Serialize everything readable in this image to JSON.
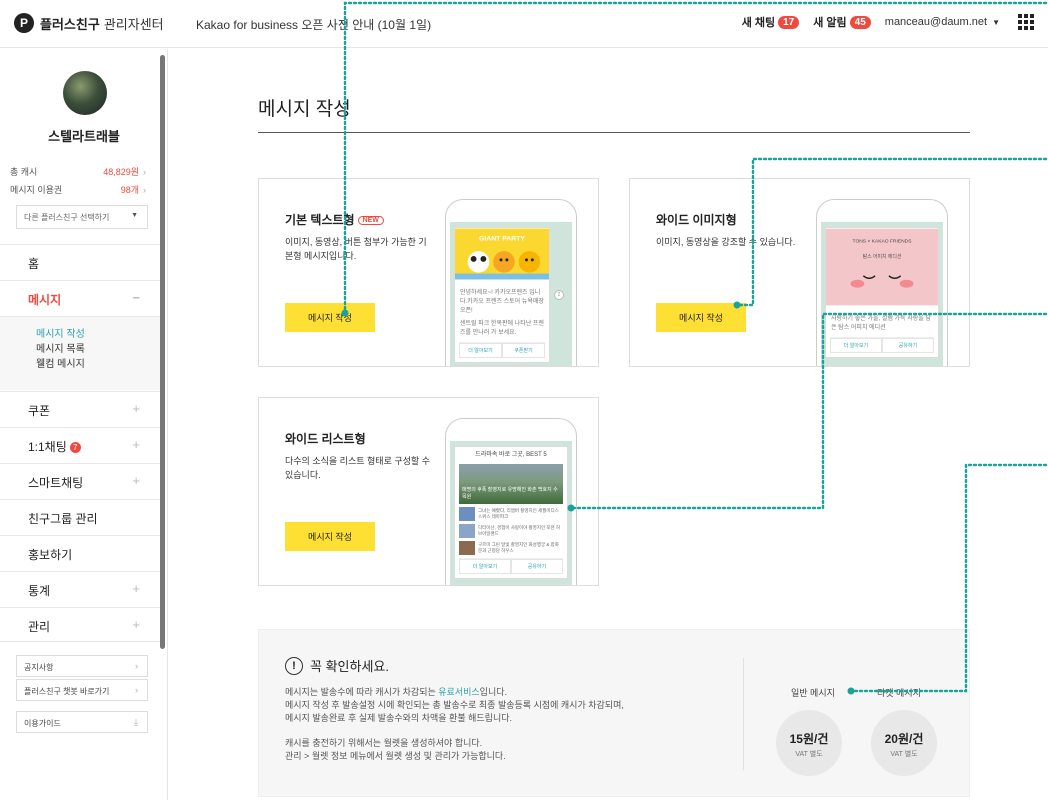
{
  "header": {
    "logo_mark": "P",
    "brand": "플러스친구",
    "brand_sub": "관리자센터",
    "notice": "Kakao for business 오픈 사전 안내 (10월 1일)",
    "new_chat_label": "새 채팅",
    "new_chat_count": "17",
    "new_alert_label": "새 알림",
    "new_alert_count": "45",
    "account": "manceau@daum.net"
  },
  "sidebar": {
    "profile_name": "스텔라트래블",
    "cash_label": "총 캐시",
    "cash_value": "48,829원",
    "voucher_label": "메시지 이용권",
    "voucher_value": "98개",
    "friend_select": "다른 플러스친구 선택하기",
    "menu": {
      "home": "홈",
      "message": "메시지",
      "coupon": "쿠폰",
      "chat": "1:1채팅",
      "chat_dot": "7",
      "smart_chat": "스마트채팅",
      "friend_group": "친구그룹 관리",
      "promote": "홍보하기",
      "stats": "통계",
      "manage": "관리"
    },
    "submenu": [
      "메시지 작성",
      "메시지 목록",
      "웰컴 메시지"
    ],
    "notice_btn": "공지사항",
    "chatbot_btn": "플러스친구 챗봇 바로가기",
    "guide_btn": "이용가이드"
  },
  "main": {
    "page_title": "메시지 작성",
    "cards": [
      {
        "title": "기본 텍스트형",
        "badge": "NEW",
        "desc": "이미지, 동영상, 버튼 첨부가 가능한 기본형 메시지입니다.",
        "button": "메시지 작성",
        "preview": {
          "banner": "GIANT PARTY",
          "text1": "안녕하세요~! 카카오프렌즈 입니다.카카오 프렌즈 스토어 뉴욕매장 오픈!",
          "text2": "센트럴 파크 한복판에 나타난 프렌즈를 만나러 가 보세요.",
          "btn1": "더 알아보기",
          "btn2": "쿠폰받기"
        }
      },
      {
        "title": "와이드 이미지형",
        "desc": "이미지, 동영상을 강조할 수 있습니다.",
        "button": "메시지 작성",
        "preview": {
          "banner": "TONS × KAKAO FRIENDS",
          "banner_sub": "탐스 어피치 에디션",
          "text1": "사랑하기 좋은 가을, 설렘 가득 사랑을 담은 탐스 어피치 에디션",
          "btn1": "더 알아보기",
          "btn2": "공유하기"
        }
      },
      {
        "title": "와이드 리스트형",
        "desc": "다수의 소식을 리스트 형태로 구성할 수 있습니다.",
        "button": "메시지 작성",
        "preview": {
          "header": "드라마속 바로 그곳, BEST 5",
          "hero": "매명의 후폭 촬영지로 유명해진 화촌 백호지 수목원",
          "items": [
            "그녀는 예뻤다, 리멤버 촬영지인 세월미디스 스위스 테마파크",
            "닥터이산, 경험이 사랑이야 촬영지인 포천 허브아일랜드",
            "구르미 그린 달빛 촬영지인 화성행궁 & 함화문과 근정당 하우스"
          ],
          "btn1": "더 알아보기",
          "btn2": "공유하기"
        }
      }
    ]
  },
  "notice_box": {
    "title": "꼭 확인하세요.",
    "line1_pre": "메시지는 발송수에 따라 캐시가 차감되는 ",
    "line1_link": "유료서비스",
    "line1_post": "입니다.",
    "line2": "메시지 작성 후 발송설정 시에 확인되는 총 발송수로 최종 발송등록 시점에 캐시가 차감되며,",
    "line3": "메시지 발송완료 후 실제 발송수와의 차액을 환불 해드립니다.",
    "line4": "캐시를 충전하기 위해서는 월렛을 생성하셔야 합니다.",
    "line5": "관리 > 월렛 정보 메뉴에서 월렛 생성 및 관리가 가능합니다.",
    "general_label": "일반 메시지",
    "general_price": "15원/건",
    "general_vat": "VAT 별도",
    "target_label": "타겟 메시지",
    "target_price": "20원/건",
    "target_vat": "VAT 별도"
  },
  "colors": {
    "accent_yellow": "#fde033",
    "accent_red": "#f04a3e",
    "teal_annotation": "#1aa39a",
    "link_teal": "#2aa3ad"
  }
}
